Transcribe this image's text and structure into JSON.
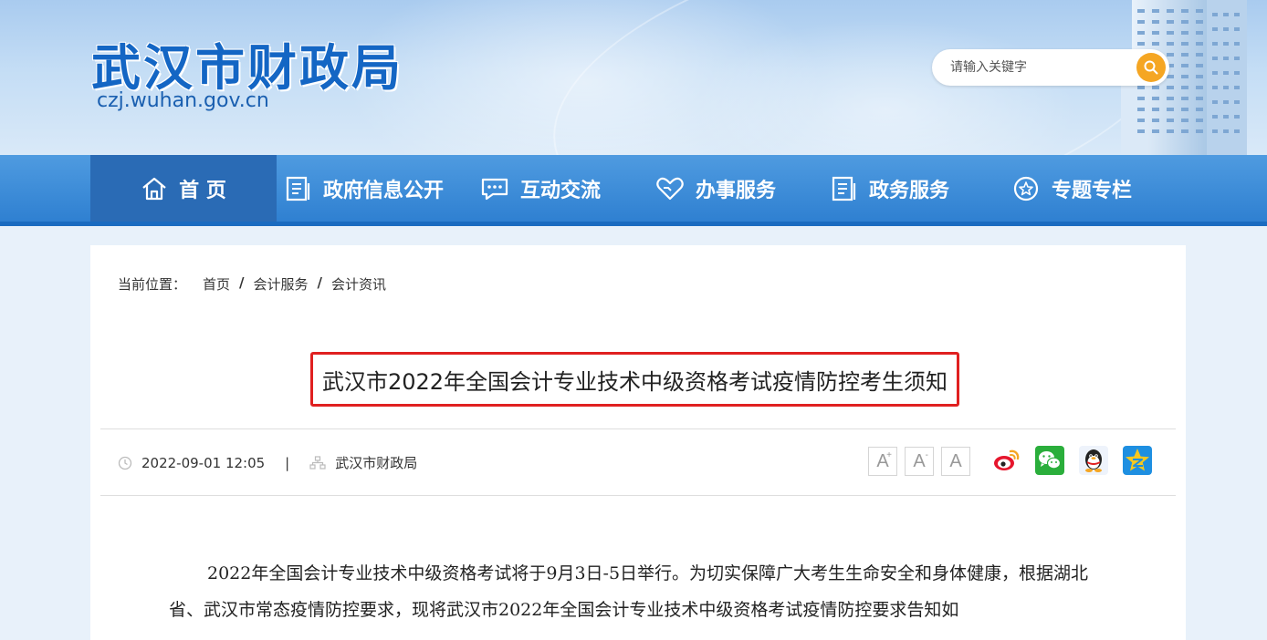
{
  "header": {
    "site_title": "武汉市财政局",
    "site_domain": "czj.wuhan.gov.cn",
    "search_placeholder": "请输入关键字"
  },
  "nav": {
    "items": [
      {
        "label": "首 页",
        "icon": "home-icon"
      },
      {
        "label": "政府信息公开",
        "icon": "document-list-icon"
      },
      {
        "label": "互动交流",
        "icon": "chat-bubble-icon"
      },
      {
        "label": "办事服务",
        "icon": "heart-hands-icon"
      },
      {
        "label": "政务服务",
        "icon": "document-list-icon"
      },
      {
        "label": "专题专栏",
        "icon": "star-circle-icon"
      }
    ]
  },
  "breadcrumb": {
    "label": "当前位置：",
    "items": [
      "首页",
      "会计服务",
      "会计资讯"
    ],
    "separator": "/"
  },
  "article": {
    "title": "武汉市2022年全国会计专业技术中级资格考试疫情防控考生须知",
    "datetime": "2022-09-01 12:05",
    "divider": "|",
    "source": "武汉市财政局",
    "font_size_buttons": [
      "A",
      "A",
      "A"
    ],
    "body": "2022年全国会计专业技术中级资格考试将于9月3日-5日举行。为切实保障广大考生生命安全和身体健康，根据湖北省、武汉市常态疫情防控要求，现将武汉市2022年全国会计专业技术中级资格考试疫情防控要求告知如"
  },
  "share": [
    "weibo-icon",
    "wechat-icon",
    "qq-icon",
    "qzone-icon"
  ],
  "colors": {
    "nav_bg": "#3a88d6",
    "nav_active": "#2a6bb5",
    "title_border": "#e02020",
    "search_button": "#f5a623",
    "brand_blue": "#1466c4"
  }
}
